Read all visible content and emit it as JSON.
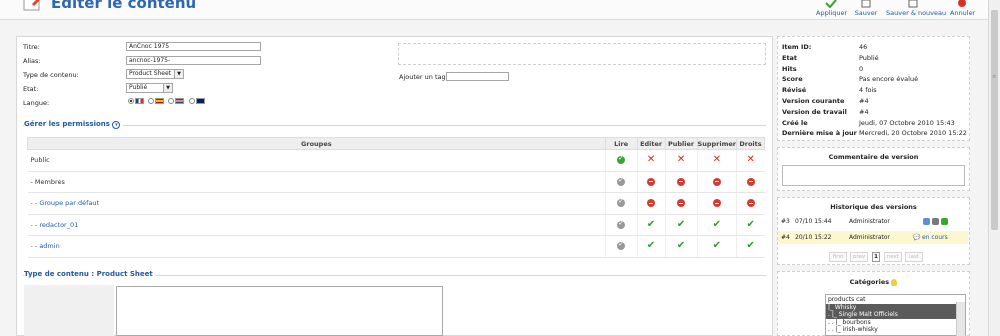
{
  "header": {
    "title": "Editer le contenu",
    "toolbar": {
      "apply": "Appliquer",
      "save": "Sauver",
      "save_new": "Sauver & nouveau",
      "cancel": "Annuler"
    }
  },
  "form": {
    "title_label": "Titre:",
    "title_value": "AnCnoc 1975",
    "alias_label": "Alias:",
    "alias_value": "ancnoc-1975-",
    "type_label": "Type de contenu:",
    "type_value": "Product Sheet",
    "state_label": "Etat:",
    "state_value": "Publié",
    "language_label": "Langue:",
    "tag_label": "Ajouter un tag:"
  },
  "permissions": {
    "title": "Gérer les permissions",
    "columns": [
      "Groupes",
      "Lire",
      "Editer",
      "Publier",
      "Supprimer",
      "Droits"
    ],
    "rows": [
      {
        "group": "Public",
        "link": false,
        "marks": [
          "ok-green",
          "x",
          "x",
          "x",
          "x"
        ]
      },
      {
        "group": "- Membres",
        "link": false,
        "marks": [
          "ok-grey",
          "deny",
          "deny",
          "deny",
          "deny"
        ]
      },
      {
        "group": "- - Groupe par défaut",
        "link": true,
        "marks": [
          "ok-grey",
          "deny",
          "deny",
          "deny",
          "deny"
        ]
      },
      {
        "group": "- - redactor_01",
        "link": true,
        "marks": [
          "ok-grey",
          "v",
          "v",
          "v",
          "v"
        ]
      },
      {
        "group": "- - admin",
        "link": true,
        "marks": [
          "ok-grey",
          "v",
          "v",
          "v",
          "v"
        ]
      }
    ]
  },
  "content_type_section": {
    "title": "Type de contenu : Product Sheet"
  },
  "info": {
    "rows": [
      {
        "k": "Item ID:",
        "v": "46"
      },
      {
        "k": "Etat",
        "v": "Publié"
      },
      {
        "k": "Hits",
        "v": "0"
      },
      {
        "k": "Score",
        "v": "Pas encore évalué"
      },
      {
        "k": "Révisé",
        "v": "4 fois"
      },
      {
        "k": "Version courante",
        "v": "#4"
      },
      {
        "k": "Version de travail",
        "v": "#4"
      },
      {
        "k": "Créé le",
        "v": "Jeudi, 07 Octobre 2010 15:43"
      },
      {
        "k": "Dernière mise à jour",
        "v": "Mercredi, 20 Octobre 2010 15:22"
      }
    ]
  },
  "version_comment": {
    "title": "Commentaire de version"
  },
  "history": {
    "title": "Historique des versions",
    "rows": [
      {
        "num": "#3",
        "date": "07/10 15:44",
        "user": "Administrator",
        "status": ""
      },
      {
        "num": "#4",
        "date": "20/10 15:22",
        "user": "Administrator",
        "status": "en cours"
      }
    ],
    "pager": [
      "first",
      "prev",
      "1",
      "next",
      "last"
    ]
  },
  "categories": {
    "title": "Catégories",
    "items": [
      "products cat",
      "|_ Whisky",
      ". |_ Single Malt Officiels",
      ". . |_ bourbons",
      ". . |_ irish-whisky"
    ]
  },
  "colors": {
    "accent": "#1e5aa8",
    "highlight_row": "#fdf7cf",
    "selected": "#5b5b5b"
  }
}
